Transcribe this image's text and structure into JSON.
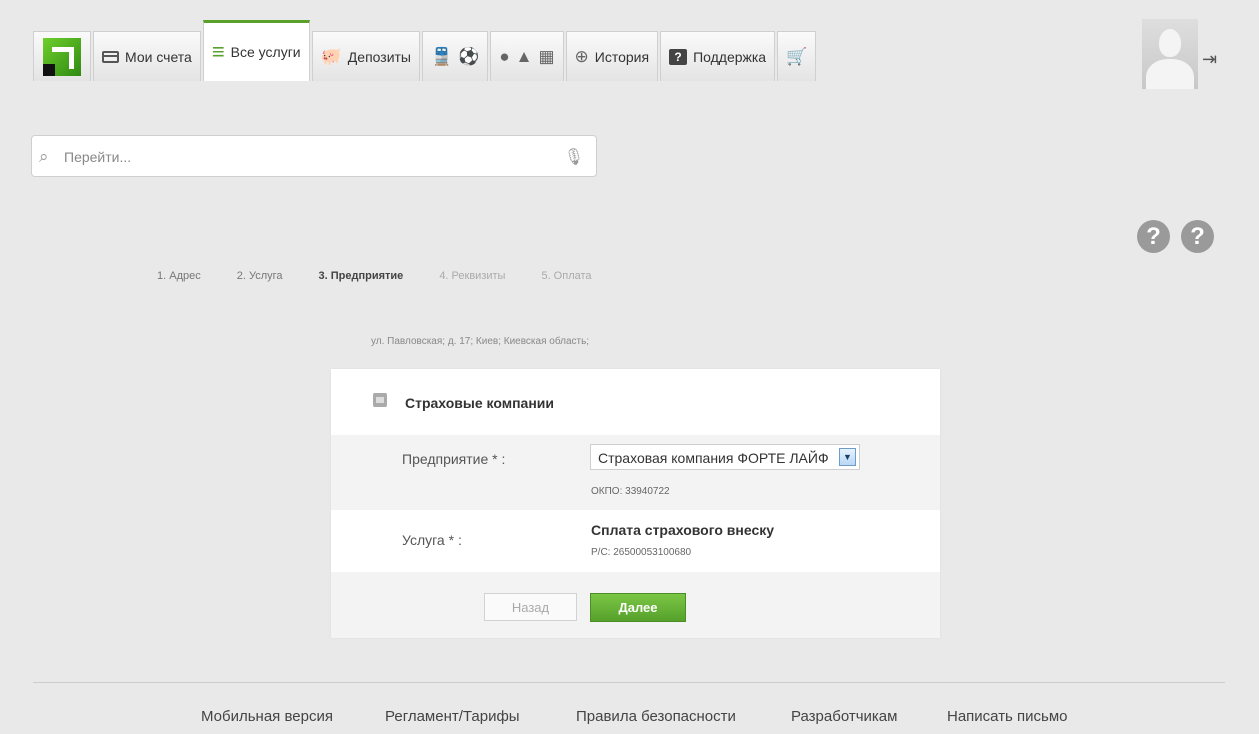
{
  "nav": {
    "tabs": [
      {
        "label": "Мои счета",
        "icon": "credit-card-icon"
      },
      {
        "label": "Все услуги",
        "icon": "list-icon",
        "active": true
      },
      {
        "label": "Депозиты",
        "icon": "piggy-bank-icon"
      },
      {
        "label": "",
        "icon": "transport-tickets-icon"
      },
      {
        "label": "",
        "icon": "mobile-platforms-icon"
      },
      {
        "label": "История",
        "icon": "history-icon"
      },
      {
        "label": "Поддержка",
        "icon": "help-icon"
      },
      {
        "label": "",
        "icon": "cart-icon"
      }
    ]
  },
  "search": {
    "placeholder": "Перейти..."
  },
  "steps": [
    {
      "label": "1.  Адрес",
      "state": "done"
    },
    {
      "label": "2.  Услуга",
      "state": "done"
    },
    {
      "label": "3.  Предприятие",
      "state": "current"
    },
    {
      "label": "4.  Реквизиты",
      "state": "pending"
    },
    {
      "label": "5.  Оплата",
      "state": "pending"
    }
  ],
  "address": "ул. Павловская; д. 17; Киев; Киевская область;",
  "panel": {
    "title": "Страховые компании",
    "enterprise_label": "Предприятие * :",
    "enterprise_value": "Страховая компания ФОРТЕ ЛАЙФ",
    "okpo": "ОКПО: 33940722",
    "service_label": "Услуга * :",
    "service_name": "Сплата страхового внеску",
    "service_account": "Р/С: 26500053100680",
    "back_label": "Назад",
    "next_label": "Далее"
  },
  "footer": {
    "links": [
      "Мобильная версия",
      "Регламент/Тарифы",
      "Правила безопасности",
      "Разработчикам",
      "Написать письмо"
    ]
  },
  "colors": {
    "accent": "#5aa12b",
    "background": "#e9e9e9"
  }
}
